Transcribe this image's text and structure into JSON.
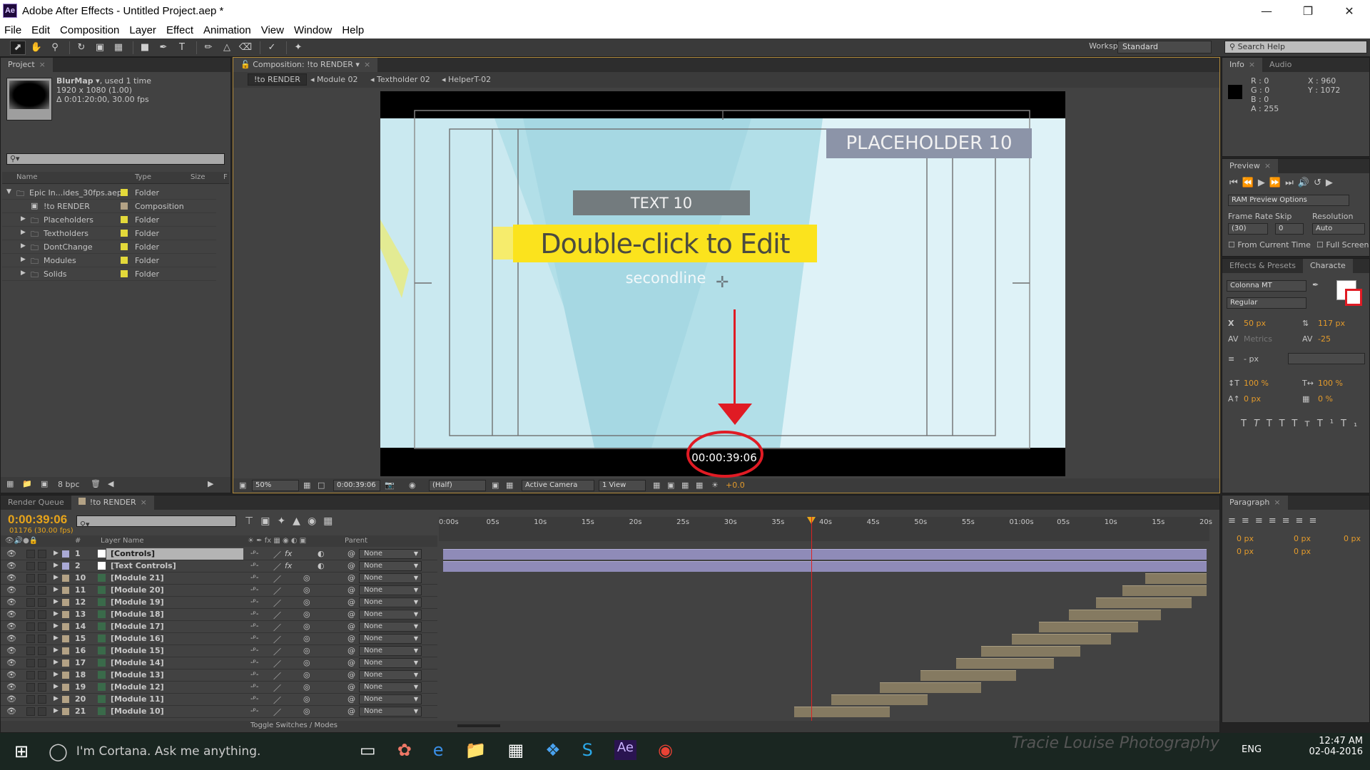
{
  "window": {
    "title": "Adobe After Effects - Untitled Project.aep *",
    "app_icon": "Ae",
    "buttons": [
      "minimize",
      "restore",
      "close"
    ]
  },
  "menu": [
    "File",
    "Edit",
    "Composition",
    "Layer",
    "Effect",
    "Animation",
    "View",
    "Window",
    "Help"
  ],
  "toolbar": {
    "tools": [
      "selection-tool",
      "hand-tool",
      "zoom-tool",
      "rotation-tool",
      "camera-tool",
      "pan-behind-tool",
      "shape-tool",
      "pen-tool",
      "type-tool",
      "brush-tool",
      "clone-stamp-tool",
      "eraser-tool",
      "roto-brush-tool",
      "puppet-pin-tool"
    ],
    "workspace_label": "Workspace:",
    "workspace_value": "Standard",
    "search_help_placeholder": "Search Help"
  },
  "project": {
    "tab": "Project",
    "selected_item": {
      "name": "BlurMap",
      "usage": ", used 1 time",
      "size": "1920 x 1080 (1.00)",
      "duration": "Δ 0:01:20:00, 30.00 fps"
    },
    "columns": [
      "Name",
      "Type",
      "Size",
      "F"
    ],
    "items": [
      {
        "name": "Epic In...ides_30fps.aep",
        "type": "Folder",
        "color": "#e3d93a",
        "indent": 0,
        "expanded": true
      },
      {
        "name": "!to RENDER",
        "type": "Composition",
        "color": "#b3a285",
        "indent": 1,
        "expanded": false
      },
      {
        "name": "Placeholders",
        "type": "Folder",
        "color": "#e3d93a",
        "indent": 1,
        "expanded": false
      },
      {
        "name": "Textholders",
        "type": "Folder",
        "color": "#e3d93a",
        "indent": 1,
        "expanded": false
      },
      {
        "name": "DontChange",
        "type": "Folder",
        "color": "#e3d93a",
        "indent": 1,
        "expanded": false
      },
      {
        "name": "Modules",
        "type": "Folder",
        "color": "#e3d93a",
        "indent": 1,
        "expanded": false
      },
      {
        "name": "Solids",
        "type": "Folder",
        "color": "#e3d93a",
        "indent": 1,
        "expanded": false
      }
    ],
    "footer_bpc": "8 bpc"
  },
  "composition": {
    "tab": "Composition: !to RENDER",
    "breadcrumbs": [
      "!to RENDER",
      "Module 02",
      "Textholder 02",
      "HelperT-02"
    ],
    "viewer": {
      "placeholder_text": "PLACEHOLDER 10",
      "text_label": "TEXT 10",
      "headline": "Double-click to Edit",
      "subline": "secondline",
      "overlay_timecode": "00:00:39:06"
    },
    "bottom_bar": {
      "zoom": "50%",
      "timecode": "0:00:39:06",
      "resolution": "(Half)",
      "camera": "Active Camera",
      "views": "1 View",
      "exposure": "+0.0"
    }
  },
  "info": {
    "tabs": [
      "Info",
      "Audio"
    ],
    "r": "R : 0",
    "g": "G : 0",
    "b": "B : 0",
    "a": "A : 255",
    "x": "X : 960",
    "y": "Y : 1072"
  },
  "preview": {
    "tab": "Preview",
    "ram_options": "RAM Preview Options",
    "frame_rate_label": "Frame Rate",
    "skip_label": "Skip",
    "resolution_label": "Resolution",
    "frame_rate": "(30)",
    "skip": "0",
    "resolution": "Auto",
    "from_current_time": "From Current Time",
    "full_screen": "Full Screen"
  },
  "character": {
    "tabs": [
      "Effects & Presets",
      "Characte"
    ],
    "font": "Colonna MT",
    "style": "Regular",
    "size": "50 px",
    "leading": "117 px",
    "kerning": "Metrics",
    "tracking": "-25",
    "stroke": "- px",
    "vscale": "100 %",
    "hscale": "100 %",
    "baseline": "0 px",
    "tsume": "0 %"
  },
  "paragraph": {
    "tab": "Paragraph",
    "values": [
      "0 px",
      "0 px",
      "0 px",
      "0 px",
      "0 px"
    ]
  },
  "timeline": {
    "tabs": [
      "Render Queue",
      "!to RENDER"
    ],
    "timecode": "0:00:39:06",
    "frame_info": "01176 (30.00 fps)",
    "columns": {
      "num": "#",
      "layer_name": "Layer Name",
      "parent": "Parent"
    },
    "ruler_ticks": [
      "0:00s",
      "05s",
      "10s",
      "15s",
      "20s",
      "25s",
      "30s",
      "35s",
      "40s",
      "45s",
      "50s",
      "55s",
      "01:00s",
      "05s",
      "10s",
      "15s",
      "20s"
    ],
    "current_time_fraction": 0.49,
    "layers": [
      {
        "num": "1",
        "name": "[Controls]",
        "label_color": "#a9a9d6",
        "type": "null",
        "fx": true,
        "parent": "None",
        "selected": true,
        "bar_start": 0.0,
        "bar_end": 1.0,
        "bar_color": "#8f8bb8"
      },
      {
        "num": "2",
        "name": "[Text Controls]",
        "label_color": "#a9a9d6",
        "type": "null",
        "fx": true,
        "parent": "None",
        "selected": false,
        "bar_start": 0.0,
        "bar_end": 1.0,
        "bar_color": "#8f8bb8"
      },
      {
        "num": "10",
        "name": "[Module 21]",
        "label_color": "#b3a285",
        "type": "comp",
        "parent": "None",
        "bar_start": 0.92,
        "bar_end": 1.0
      },
      {
        "num": "11",
        "name": "[Module 20]",
        "label_color": "#b3a285",
        "type": "comp",
        "parent": "None",
        "bar_start": 0.89,
        "bar_end": 1.0
      },
      {
        "num": "12",
        "name": "[Module 19]",
        "label_color": "#b3a285",
        "type": "comp",
        "parent": "None",
        "bar_start": 0.855,
        "bar_end": 0.98
      },
      {
        "num": "13",
        "name": "[Module 18]",
        "label_color": "#b3a285",
        "type": "comp",
        "parent": "None",
        "bar_start": 0.82,
        "bar_end": 0.94
      },
      {
        "num": "14",
        "name": "[Module 17]",
        "label_color": "#b3a285",
        "type": "comp",
        "parent": "None",
        "bar_start": 0.78,
        "bar_end": 0.91
      },
      {
        "num": "15",
        "name": "[Module 16]",
        "label_color": "#b3a285",
        "type": "comp",
        "parent": "None",
        "bar_start": 0.745,
        "bar_end": 0.875
      },
      {
        "num": "16",
        "name": "[Module 15]",
        "label_color": "#b3a285",
        "type": "comp",
        "parent": "None",
        "bar_start": 0.705,
        "bar_end": 0.835
      },
      {
        "num": "17",
        "name": "[Module 14]",
        "label_color": "#b3a285",
        "type": "comp",
        "parent": "None",
        "bar_start": 0.672,
        "bar_end": 0.8
      },
      {
        "num": "18",
        "name": "[Module 13]",
        "label_color": "#b3a285",
        "type": "comp",
        "parent": "None",
        "bar_start": 0.625,
        "bar_end": 0.75
      },
      {
        "num": "19",
        "name": "[Module 12]",
        "label_color": "#b3a285",
        "type": "comp",
        "parent": "None",
        "bar_start": 0.572,
        "bar_end": 0.705
      },
      {
        "num": "20",
        "name": "[Module 11]",
        "label_color": "#b3a285",
        "type": "comp",
        "parent": "None",
        "bar_start": 0.508,
        "bar_end": 0.635
      },
      {
        "num": "21",
        "name": "[Module 10]",
        "label_color": "#b3a285",
        "type": "comp",
        "parent": "None",
        "bar_start": 0.46,
        "bar_end": 0.585
      }
    ],
    "footer_label": "Toggle Switches / Modes"
  },
  "taskbar": {
    "cortana": "I'm Cortana. Ask me anything.",
    "apps": [
      "task-view",
      "photos",
      "edge",
      "file-explorer",
      "store",
      "dropbox",
      "skype",
      "after-effects",
      "chrome"
    ],
    "language": "ENG",
    "time": "12:47 AM",
    "date": "02-04-2016",
    "watermark": "Tracie Louise Photography"
  }
}
